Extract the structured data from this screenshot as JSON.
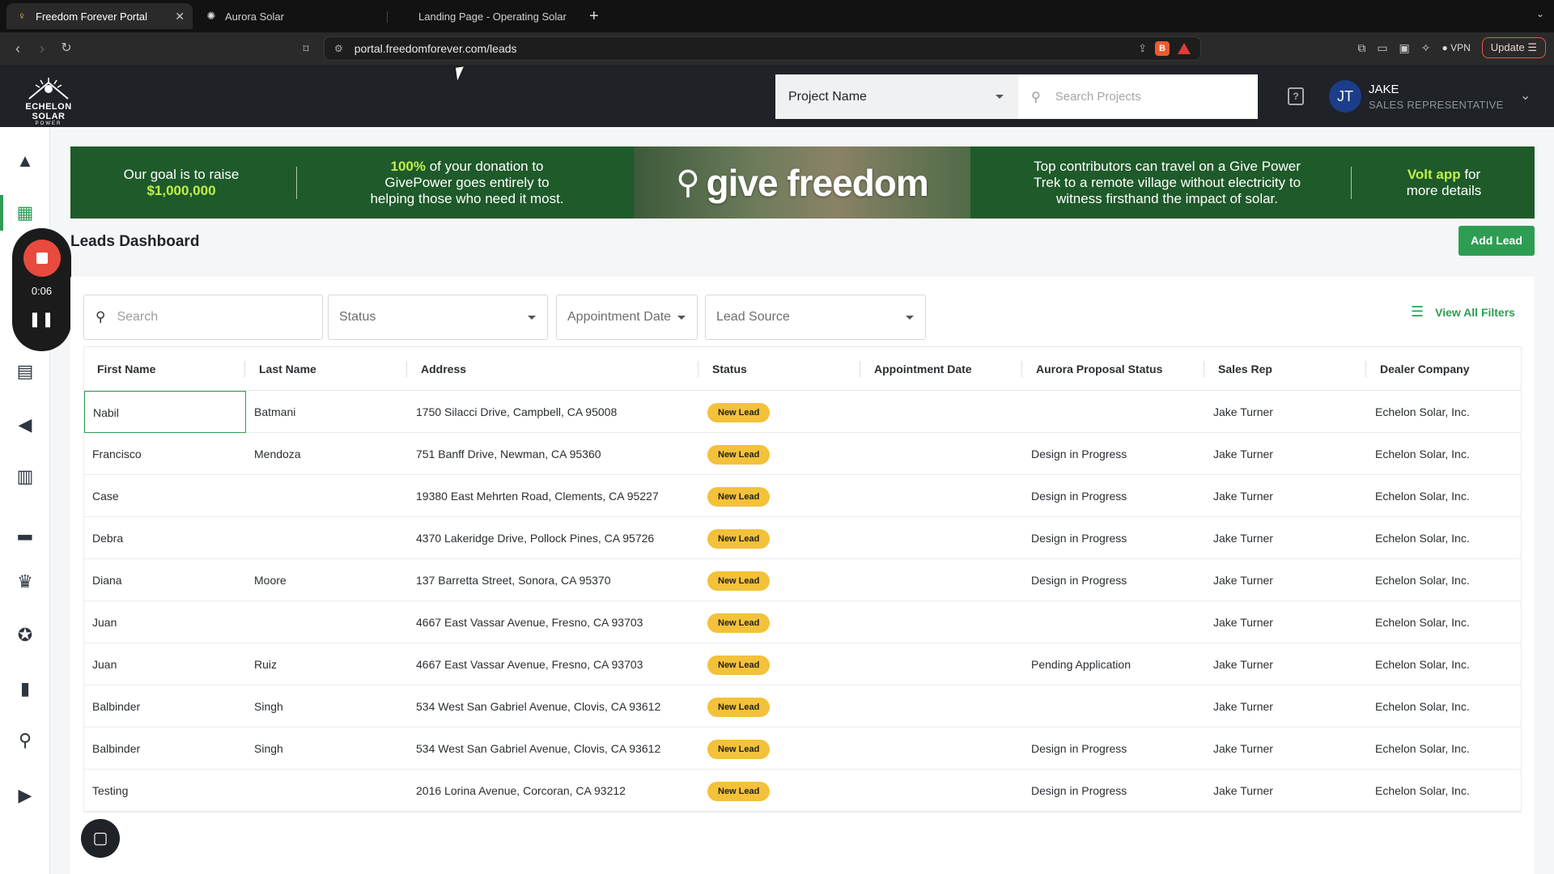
{
  "browser": {
    "tabs": [
      {
        "title": "Freedom Forever Portal",
        "active": true,
        "icon": "bulb-icon"
      },
      {
        "title": "Aurora Solar",
        "active": false,
        "icon": "sun-icon"
      },
      {
        "title": "Landing Page - Operating Solar P",
        "active": false,
        "icon": ""
      }
    ],
    "url": "portal.freedomforever.com/leads",
    "vpn_label": "VPN",
    "update_label": "Update"
  },
  "header": {
    "logo_text": "ECHELON SOLAR",
    "logo_sub": "POWER",
    "project_select": "Project Name",
    "search_placeholder": "Search Projects",
    "user_initials": "JT",
    "user_name": "JAKE",
    "user_role": "SALES REPRESENTATIVE"
  },
  "recorder": {
    "time": "0:06"
  },
  "banner": {
    "seg1_line1": "Our goal is to raise",
    "seg1_line2": "$1,000,000",
    "seg2_hl": "100%",
    "seg2_line1_rest": " of your donation to",
    "seg2_line2": "GivePower goes entirely to",
    "seg2_line3": "helping those who need it most.",
    "brand": "give freedom",
    "seg3_line1": "Top contributors can travel on a Give Power",
    "seg3_line2": "Trek to a remote village without electricity to",
    "seg3_line3": "witness firsthand the impact of solar.",
    "seg4_hl": "Volt app",
    "seg4_line1_rest": " for",
    "seg4_line2": "more details"
  },
  "page": {
    "title": "Leads Dashboard",
    "add_lead": "Add Lead"
  },
  "filters": {
    "search_placeholder": "Search",
    "status": "Status",
    "appointment_date": "Appointment Date",
    "lead_source": "Lead Source",
    "view_all": "View All Filters"
  },
  "table": {
    "columns": [
      "First Name",
      "Last Name",
      "Address",
      "Status",
      "Appointment Date",
      "Aurora Proposal Status",
      "Sales Rep",
      "Dealer Company"
    ],
    "rows": [
      {
        "first": "Nabil",
        "last": "Batmani",
        "address": "1750 Silacci Drive, Campbell, CA 95008",
        "status": "New Lead",
        "appt": "",
        "aurora": "",
        "rep": "Jake Turner",
        "dealer": "Echelon Solar, Inc."
      },
      {
        "first": "Francisco",
        "last": "Mendoza",
        "address": "751 Banff Drive, Newman, CA 95360",
        "status": "New Lead",
        "appt": "",
        "aurora": "Design in Progress",
        "rep": "Jake Turner",
        "dealer": "Echelon Solar, Inc."
      },
      {
        "first": "Case",
        "last": "",
        "address": "19380 East Mehrten Road, Clements, CA 95227",
        "status": "New Lead",
        "appt": "",
        "aurora": "Design in Progress",
        "rep": "Jake Turner",
        "dealer": "Echelon Solar, Inc."
      },
      {
        "first": "Debra",
        "last": "",
        "address": "4370 Lakeridge Drive, Pollock Pines, CA 95726",
        "status": "New Lead",
        "appt": "",
        "aurora": "Design in Progress",
        "rep": "Jake Turner",
        "dealer": "Echelon Solar, Inc."
      },
      {
        "first": "Diana",
        "last": "Moore",
        "address": "137 Barretta Street, Sonora, CA 95370",
        "status": "New Lead",
        "appt": "",
        "aurora": "Design in Progress",
        "rep": "Jake Turner",
        "dealer": "Echelon Solar, Inc."
      },
      {
        "first": "Juan",
        "last": "",
        "address": "4667 East Vassar Avenue, Fresno, CA 93703",
        "status": "New Lead",
        "appt": "",
        "aurora": "",
        "rep": "Jake Turner",
        "dealer": "Echelon Solar, Inc."
      },
      {
        "first": "Juan",
        "last": "Ruiz",
        "address": "4667 East Vassar Avenue, Fresno, CA 93703",
        "status": "New Lead",
        "appt": "",
        "aurora": "Pending Application",
        "rep": "Jake Turner",
        "dealer": "Echelon Solar, Inc."
      },
      {
        "first": "Balbinder",
        "last": "Singh",
        "address": "534 West San Gabriel Avenue, Clovis, CA 93612",
        "status": "New Lead",
        "appt": "",
        "aurora": "",
        "rep": "Jake Turner",
        "dealer": "Echelon Solar, Inc."
      },
      {
        "first": "Balbinder",
        "last": "Singh",
        "address": "534 West San Gabriel Avenue, Clovis, CA 93612",
        "status": "New Lead",
        "appt": "",
        "aurora": "Design in Progress",
        "rep": "Jake Turner",
        "dealer": "Echelon Solar, Inc."
      },
      {
        "first": "Testing",
        "last": "",
        "address": "2016 Lorina Avenue, Corcoran, CA 93212",
        "status": "New Lead",
        "appt": "",
        "aurora": "Design in Progress",
        "rep": "Jake Turner",
        "dealer": "Echelon Solar, Inc."
      }
    ]
  },
  "colors": {
    "accent_green": "#2e9d54",
    "badge_yellow": "#f3c13a",
    "header_dark": "#1f2227",
    "banner_green": "#1f5a2a",
    "banner_highlight": "#bff04a",
    "recorder_red": "#e84a3e"
  }
}
